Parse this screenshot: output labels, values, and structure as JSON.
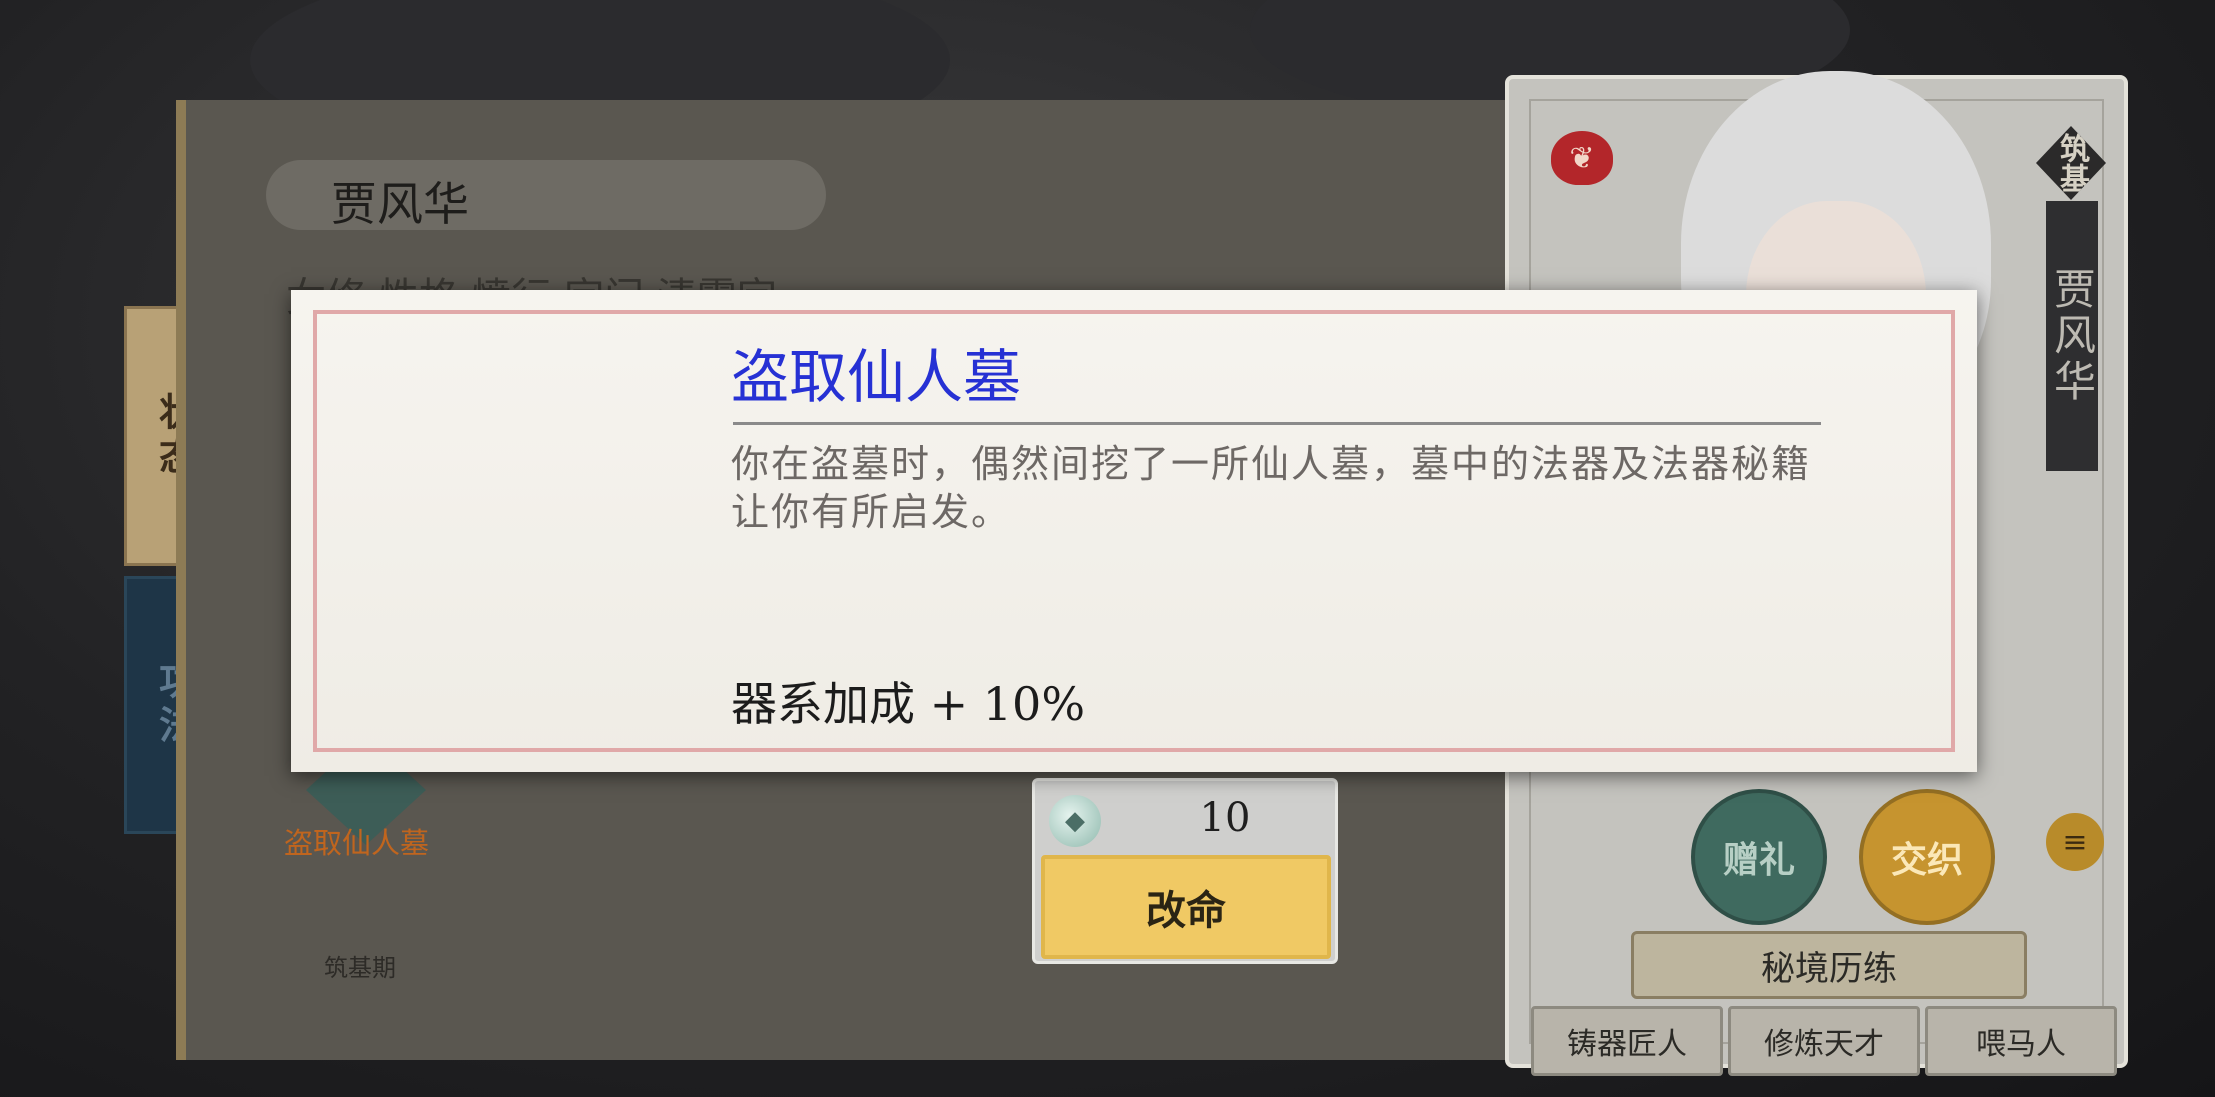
{
  "tabs": {
    "status": "状态",
    "skill": "功法"
  },
  "panel": {
    "name": "贾风华",
    "info_row": "女修    性格 愤行    宗门 清霄宗",
    "skill_badge_label": "盗取仙人墓",
    "realm": "筑基期"
  },
  "character_card": {
    "rank": "筑基",
    "name": "贾风华",
    "gift_label": "赠礼",
    "bond_label": "交织",
    "secret_realm_label": "秘境历练",
    "traits": [
      "铸器匠人",
      "修炼天才",
      "喂马人"
    ]
  },
  "change_fate": {
    "cost": "10",
    "button_label": "改命"
  },
  "event_popup": {
    "title": "盗取仙人墓",
    "description": "你在盗墓时，偶然间挖了一所仙人墓，墓中的法器及法器秘籍让你有所启发。",
    "bonus": "器系加成 + 10%"
  },
  "colors": {
    "title_blue": "#2631d4",
    "button_gold": "#f0c964",
    "tab_active": "#b8a176",
    "tab_inactive": "#1e3547"
  }
}
